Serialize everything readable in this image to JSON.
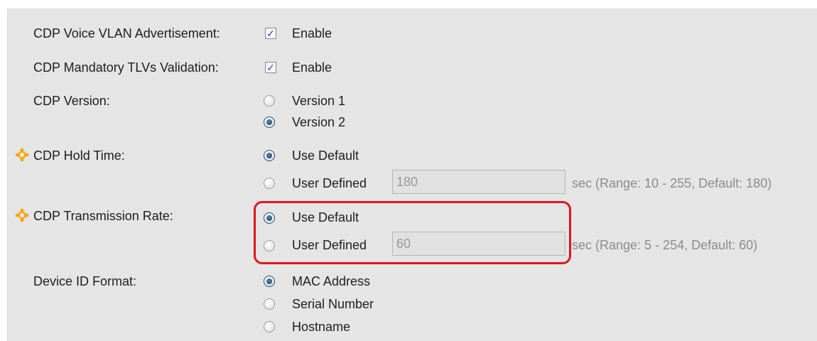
{
  "cdp_voice_vlan": {
    "label": "CDP Voice VLAN Advertisement:",
    "checked": true,
    "option": "Enable"
  },
  "cdp_tlv_validation": {
    "label": "CDP Mandatory TLVs Validation:",
    "checked": true,
    "option": "Enable"
  },
  "cdp_version": {
    "label": "CDP Version:",
    "options": [
      "Version 1",
      "Version 2"
    ],
    "selected": "Version 2"
  },
  "hold_time": {
    "label": "CDP Hold Time:",
    "use_default": "Use Default",
    "user_defined": "User Defined",
    "value": "180",
    "hint": "sec (Range: 10 - 255, Default: 180)",
    "selected": "Use Default"
  },
  "transmission_rate": {
    "label": "CDP Transmission Rate:",
    "use_default": "Use Default",
    "user_defined": "User Defined",
    "value": "60",
    "hint": "sec (Range: 5 - 254, Default: 60)",
    "selected": "Use Default"
  },
  "device_id_format": {
    "label": "Device ID Format:",
    "options": [
      "MAC Address",
      "Serial Number",
      "Hostname"
    ],
    "selected": "MAC Address"
  },
  "colors": {
    "highlight": "#e0141e",
    "radio_selected": "#1e3f66",
    "required_marker": "#f4a11a"
  },
  "icons": {
    "required_marker": "gear-icon",
    "checkmark": "checkmark-icon"
  }
}
